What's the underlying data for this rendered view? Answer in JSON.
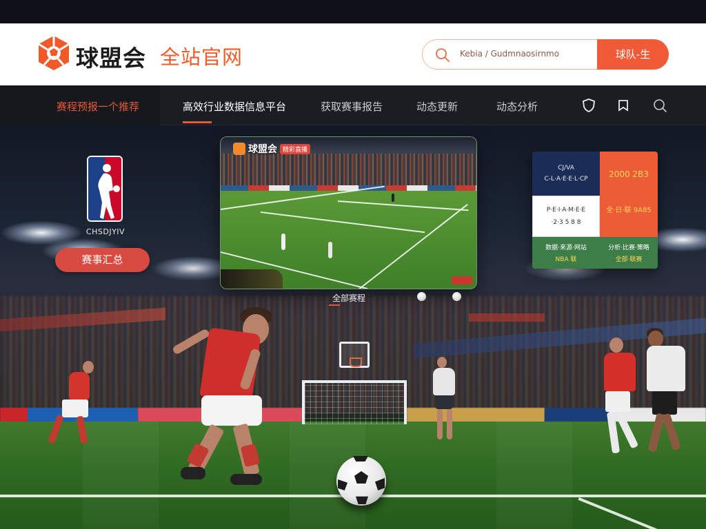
{
  "header": {
    "brand": "球盟会",
    "brand_sub": "全站官网",
    "search_placeholder": "Kebia / Gudmnaosirnmo",
    "search_button": "球队-生"
  },
  "nav": {
    "items": [
      {
        "label": "赛程预报一个推荐"
      },
      {
        "label": "高效行业数据信息平台"
      },
      {
        "label": "获取赛事报告"
      },
      {
        "label": "动态更新"
      },
      {
        "label": "动态分析"
      }
    ],
    "icons": [
      "shield-icon",
      "bookmark-icon",
      "search-icon"
    ]
  },
  "left": {
    "logo_caption": "CHSDJYIV",
    "button": "赛事汇总"
  },
  "video": {
    "badge_text": "球盟会",
    "badge_tag": "精彩直播",
    "caption": "全部赛程"
  },
  "stats": {
    "navy_lines": [
      "CJ/VA",
      "C-L·A·E·E·L·CP"
    ],
    "orange_line1": "2000 2B3",
    "orange_line2": "全·日·联 9A85",
    "white_lines": [
      "P·E·I·A·M·E·E",
      "·2·3 5 8 8"
    ],
    "green1_lines": [
      "数据·来源·网站",
      "NBA 联"
    ],
    "green2_lines": [
      "分析·比赛·策略",
      "全部·联赛"
    ]
  },
  "colors": {
    "accent": "#f05a36",
    "nav_bg": "#1a1d22",
    "brand_orange": "#e9573a"
  }
}
